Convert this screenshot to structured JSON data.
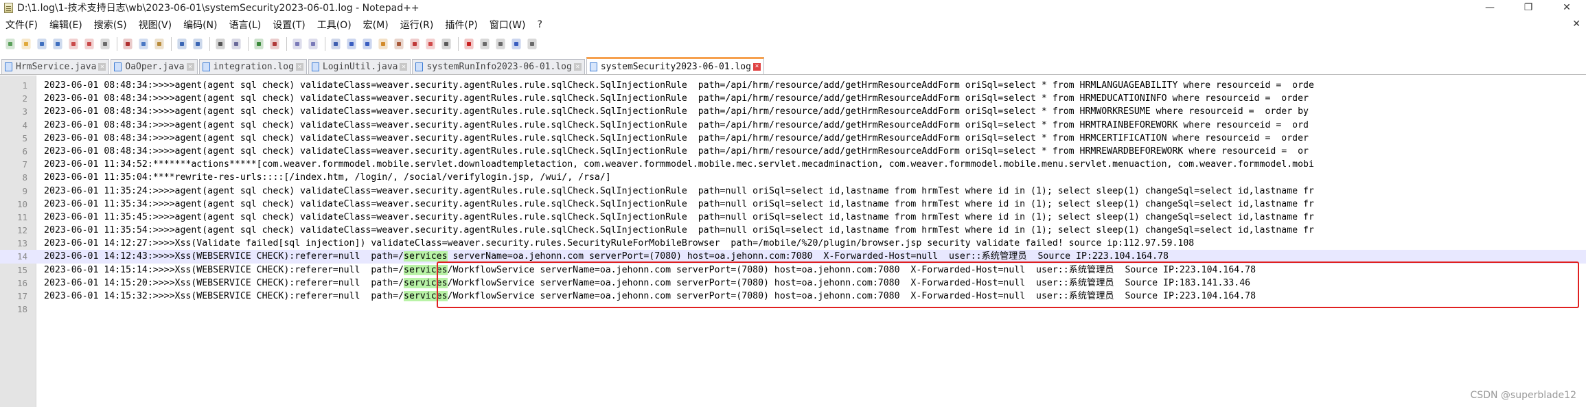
{
  "window": {
    "title": "D:\\1.log\\1-技术支持日志\\wb\\2023-06-01\\systemSecurity2023-06-01.log - Notepad++",
    "controls": [
      "—",
      "❐",
      "✕"
    ]
  },
  "menu": {
    "items": [
      "文件(F)",
      "编辑(E)",
      "搜索(S)",
      "视图(V)",
      "编码(N)",
      "语言(L)",
      "设置(T)",
      "工具(O)",
      "宏(M)",
      "运行(R)",
      "插件(P)",
      "窗口(W)",
      "?"
    ],
    "close_glyph": "✕"
  },
  "toolbar": {
    "buttons": [
      {
        "icon": "new-file-icon",
        "color": "#5aa05a"
      },
      {
        "icon": "open-file-icon",
        "color": "#e0a93b"
      },
      {
        "icon": "save-icon",
        "color": "#3f6fbf"
      },
      {
        "icon": "save-all-icon",
        "color": "#3f6fbf"
      },
      {
        "icon": "close-file-icon",
        "color": "#c94a4a"
      },
      {
        "icon": "close-all-icon",
        "color": "#c94a4a"
      },
      {
        "icon": "print-icon",
        "color": "#6b6b6b"
      },
      {
        "sep": true
      },
      {
        "icon": "cut-icon",
        "color": "#b03030"
      },
      {
        "icon": "copy-icon",
        "color": "#4a78c4"
      },
      {
        "icon": "paste-icon",
        "color": "#b98c3c"
      },
      {
        "sep": true
      },
      {
        "icon": "undo-icon",
        "color": "#3a66b4"
      },
      {
        "icon": "redo-icon",
        "color": "#3a66b4"
      },
      {
        "sep": true
      },
      {
        "icon": "find-icon",
        "color": "#555555"
      },
      {
        "icon": "replace-icon",
        "color": "#6a6a9a"
      },
      {
        "sep": true
      },
      {
        "icon": "zoom-in-icon",
        "color": "#3b8a3b"
      },
      {
        "icon": "zoom-out-icon",
        "color": "#b03a3a"
      },
      {
        "sep": true
      },
      {
        "icon": "sync-vertical-icon",
        "color": "#7a7ab8"
      },
      {
        "icon": "sync-horizontal-icon",
        "color": "#7a7ab8"
      },
      {
        "sep": true
      },
      {
        "icon": "word-wrap-icon",
        "color": "#4060b0"
      },
      {
        "icon": "show-all-chars-icon",
        "color": "#3a5ec0"
      },
      {
        "icon": "indent-guide-icon",
        "color": "#3a5ec0"
      },
      {
        "icon": "user-language-icon",
        "color": "#d28a2a"
      },
      {
        "icon": "doc-map-icon",
        "color": "#a85a3a"
      },
      {
        "icon": "function-list-icon",
        "color": "#c03a3a"
      },
      {
        "icon": "folder-workspace-icon",
        "color": "#d04a4a"
      },
      {
        "icon": "monitoring-icon",
        "color": "#5a5a5a"
      },
      {
        "sep": true
      },
      {
        "icon": "record-macro-icon",
        "color": "#c82020"
      },
      {
        "icon": "stop-record-icon",
        "color": "#6a6a6a"
      },
      {
        "icon": "play-macro-icon",
        "color": "#6a6a6a"
      },
      {
        "icon": "run-macro-multiple-icon",
        "color": "#3a5ec0"
      },
      {
        "icon": "save-macro-icon",
        "color": "#6a6a6a"
      }
    ]
  },
  "tabs": [
    {
      "label": "HrmService.java",
      "active": false
    },
    {
      "label": "OaOper.java",
      "active": false
    },
    {
      "label": "integration.log",
      "active": false
    },
    {
      "label": "LoginUtil.java",
      "active": false
    },
    {
      "label": "systemRunInfo2023-06-01.log",
      "active": false
    },
    {
      "label": "systemSecurity2023-06-01.log",
      "active": true
    }
  ],
  "editor": {
    "current_line": 14,
    "highlight_word": "services",
    "lines": [
      {
        "n": "1",
        "text": "2023-06-01 08:48:34:>>>>agent(agent sql check) validateClass=weaver.security.agentRules.rule.sqlCheck.SqlInjectionRule  path=/api/hrm/resource/add/getHrmResourceAddForm oriSql=select * from HRMLANGUAGEABILITY where resourceid =  orde"
      },
      {
        "n": "2",
        "text": "2023-06-01 08:48:34:>>>>agent(agent sql check) validateClass=weaver.security.agentRules.rule.sqlCheck.SqlInjectionRule  path=/api/hrm/resource/add/getHrmResourceAddForm oriSql=select * from HRMEDUCATIONINFO where resourceid =  order"
      },
      {
        "n": "3",
        "text": "2023-06-01 08:48:34:>>>>agent(agent sql check) validateClass=weaver.security.agentRules.rule.sqlCheck.SqlInjectionRule  path=/api/hrm/resource/add/getHrmResourceAddForm oriSql=select * from HRMWORKRESUME where resourceid =  order by"
      },
      {
        "n": "4",
        "text": "2023-06-01 08:48:34:>>>>agent(agent sql check) validateClass=weaver.security.agentRules.rule.sqlCheck.SqlInjectionRule  path=/api/hrm/resource/add/getHrmResourceAddForm oriSql=select * from HRMTRAINBEFOREWORK where resourceid =  ord"
      },
      {
        "n": "5",
        "text": "2023-06-01 08:48:34:>>>>agent(agent sql check) validateClass=weaver.security.agentRules.rule.sqlCheck.SqlInjectionRule  path=/api/hrm/resource/add/getHrmResourceAddForm oriSql=select * from HRMCERTIFICATION where resourceid =  order"
      },
      {
        "n": "6",
        "text": "2023-06-01 08:48:34:>>>>agent(agent sql check) validateClass=weaver.security.agentRules.rule.sqlCheck.SqlInjectionRule  path=/api/hrm/resource/add/getHrmResourceAddForm oriSql=select * from HRMREWARDBEFOREWORK where resourceid =  or"
      },
      {
        "n": "7",
        "text": "2023-06-01 11:34:52:*******actions*****[com.weaver.formmodel.mobile.servlet.downloadtempletaction, com.weaver.formmodel.mobile.mec.servlet.mecadminaction, com.weaver.formmodel.mobile.menu.servlet.menuaction, com.weaver.formmodel.mobi"
      },
      {
        "n": "8",
        "text": "2023-06-01 11:35:04:****rewrite-res-urls::::[/index.htm, /login/, /social/verifylogin.jsp, /wui/, /rsa/]"
      },
      {
        "n": "9",
        "text": "2023-06-01 11:35:24:>>>>agent(agent sql check) validateClass=weaver.security.agentRules.rule.sqlCheck.SqlInjectionRule  path=null oriSql=select id,lastname from hrmTest where id in (1); select sleep(1) changeSql=select id,lastname fr"
      },
      {
        "n": "10",
        "text": "2023-06-01 11:35:34:>>>>agent(agent sql check) validateClass=weaver.security.agentRules.rule.sqlCheck.SqlInjectionRule  path=null oriSql=select id,lastname from hrmTest where id in (1); select sleep(1) changeSql=select id,lastname fr"
      },
      {
        "n": "11",
        "text": "2023-06-01 11:35:45:>>>>agent(agent sql check) validateClass=weaver.security.agentRules.rule.sqlCheck.SqlInjectionRule  path=null oriSql=select id,lastname from hrmTest where id in (1); select sleep(1) changeSql=select id,lastname fr"
      },
      {
        "n": "12",
        "text": "2023-06-01 11:35:54:>>>>agent(agent sql check) validateClass=weaver.security.agentRules.rule.sqlCheck.SqlInjectionRule  path=null oriSql=select id,lastname from hrmTest where id in (1); select sleep(1) changeSql=select id,lastname fr"
      },
      {
        "n": "13",
        "text": "2023-06-01 14:12:27:>>>>Xss(Validate failed[sql injection]) validateClass=weaver.security.rules.SecurityRuleForMobileBrowser  path=/mobile/%20/plugin/browser.jsp security validate failed! source ip:112.97.59.108"
      },
      {
        "n": "14",
        "text": "2023-06-01 14:12:43:>>>>Xss(WEBSERVICE CHECK):referer=null  path=/services serverName=oa.jehonn.com serverPort=(7080) host=oa.jehonn.com:7080  X-Forwarded-Host=null  user::系统管理员  Source IP:223.104.164.78"
      },
      {
        "n": "15",
        "text": "2023-06-01 14:15:14:>>>>Xss(WEBSERVICE CHECK):referer=null  path=/services/WorkflowService serverName=oa.jehonn.com serverPort=(7080) host=oa.jehonn.com:7080  X-Forwarded-Host=null  user::系统管理员  Source IP:223.104.164.78"
      },
      {
        "n": "16",
        "text": "2023-06-01 14:15:20:>>>>Xss(WEBSERVICE CHECK):referer=null  path=/services/WorkflowService serverName=oa.jehonn.com serverPort=(7080) host=oa.jehonn.com:7080  X-Forwarded-Host=null  user::系统管理员  Source IP:183.141.33.46"
      },
      {
        "n": "17",
        "text": "2023-06-01 14:15:32:>>>>Xss(WEBSERVICE CHECK):referer=null  path=/services/WorkflowService serverName=oa.jehonn.com serverPort=(7080) host=oa.jehonn.com:7080  X-Forwarded-Host=null  user::系统管理员  Source IP:223.104.164.78"
      },
      {
        "n": "18",
        "text": ""
      }
    ]
  },
  "annotation": {
    "color": "#e02020"
  },
  "watermark": "CSDN @superblade12"
}
